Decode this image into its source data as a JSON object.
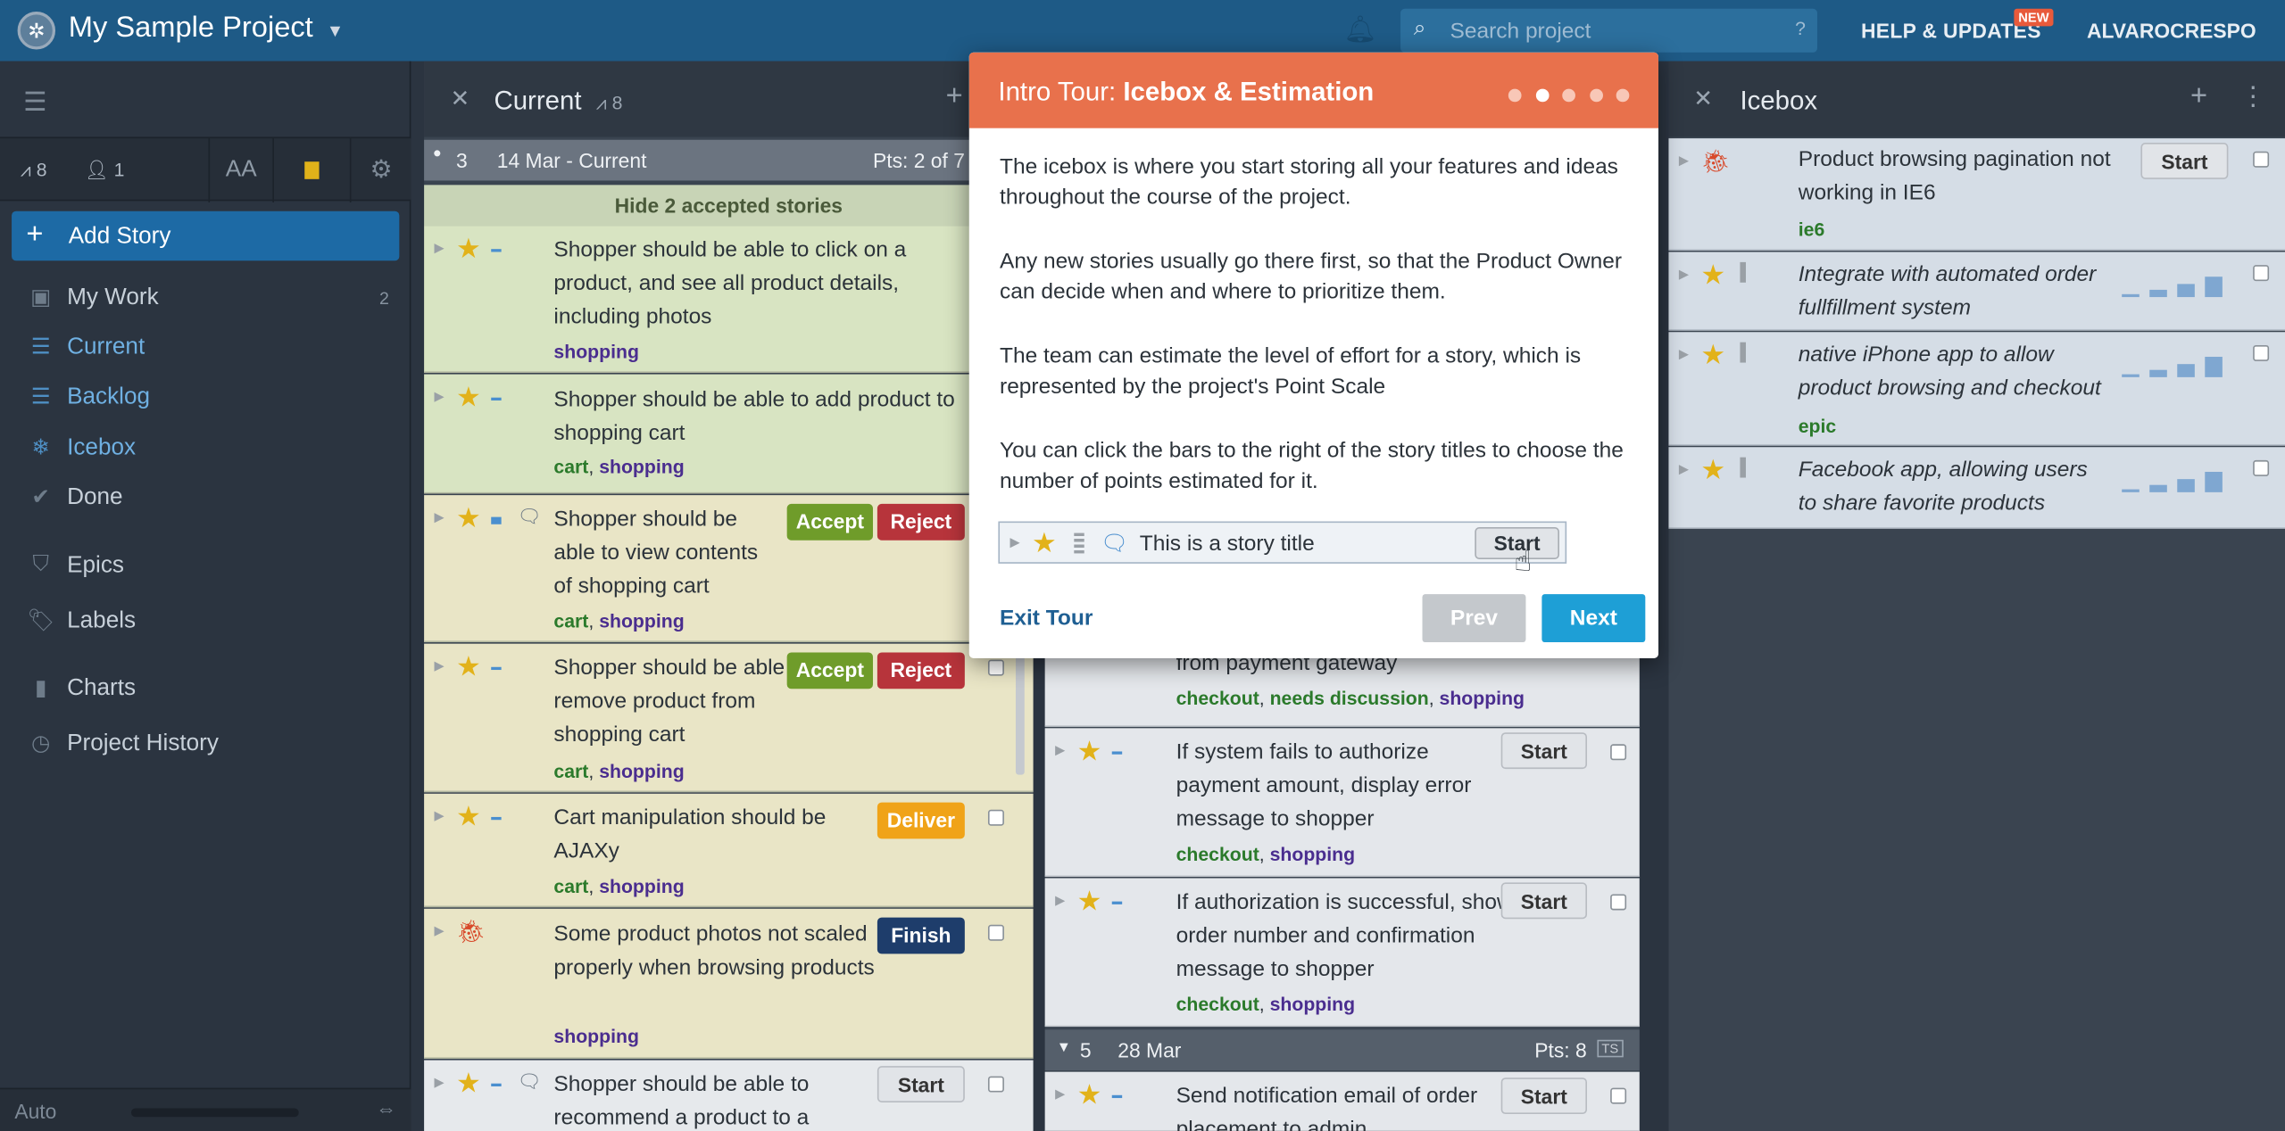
{
  "topbar": {
    "project_title": "My Sample Project",
    "search_placeholder": "Search project",
    "search_help": "?",
    "help_label": "HELP & UPDATES",
    "new_badge": "NEW",
    "username": "ALVAROCRESPO"
  },
  "sidebar": {
    "velocity": "8",
    "members": "1",
    "font_label": "AA",
    "add_story": "Add Story",
    "nav": [
      {
        "label": "My Work",
        "count": "2",
        "icon": "person-icon"
      },
      {
        "label": "Current",
        "count": "",
        "icon": "list-icon"
      },
      {
        "label": "Backlog",
        "count": "",
        "icon": "list-icon"
      },
      {
        "label": "Icebox",
        "count": "",
        "icon": "snowflake-icon"
      },
      {
        "label": "Done",
        "count": "",
        "icon": "check-icon"
      },
      {
        "label": "Epics",
        "count": "",
        "icon": "shield-icon"
      },
      {
        "label": "Labels",
        "count": "",
        "icon": "tag-icon"
      },
      {
        "label": "Charts",
        "count": "",
        "icon": "bar-chart-icon"
      },
      {
        "label": "Project History",
        "count": "",
        "icon": "clock-icon"
      }
    ],
    "bottom_auto": "Auto"
  },
  "current_panel": {
    "title": "Current",
    "velocity": "8",
    "iteration_number": "3",
    "iteration_date": "14 Mar - Current",
    "iteration_points": "Pts: 2 of 7",
    "hide_accepted": "Hide 2 accepted stories",
    "stories": [
      {
        "text": "Shopper should be able to click on a product, and see all product details, including photos",
        "labels": [
          "shopping"
        ]
      },
      {
        "text": "Shopper should be able to add product to shopping cart",
        "labels": [
          "cart",
          "shopping"
        ]
      },
      {
        "text": "Shopper should be able to view contents of shopping cart",
        "labels": [
          "cart",
          "shopping"
        ],
        "buttons": [
          "Accept",
          "Reject"
        ]
      },
      {
        "text": "Shopper should be able to remove product from shopping cart",
        "labels": [
          "cart",
          "shopping"
        ],
        "buttons": [
          "Accept",
          "Reject"
        ]
      },
      {
        "text": "Cart manipulation should be AJAXy",
        "labels": [
          "cart",
          "shopping"
        ],
        "buttons": [
          "Deliver"
        ]
      },
      {
        "text": "Some product photos not scaled properly when browsing products",
        "labels": [
          "shopping"
        ],
        "buttons": [
          "Finish"
        ]
      },
      {
        "text": "Shopper should be able to recommend a product to a",
        "labels": [],
        "buttons": [
          "Start"
        ]
      }
    ]
  },
  "backlog_panel": {
    "stories": [
      {
        "text": "from payment gateway",
        "labels": [
          "checkout",
          "needs discussion",
          "shopping"
        ]
      },
      {
        "text": "If system fails to authorize payment amount, display error message to shopper",
        "labels": [
          "checkout",
          "shopping"
        ],
        "button": "Start"
      },
      {
        "text": "If authorization is successful, show order number and confirmation message to shopper",
        "labels": [
          "checkout",
          "shopping"
        ],
        "button": "Start"
      },
      {
        "text": "Send notification email of order placement to admin",
        "labels": [],
        "button": "Start"
      }
    ],
    "iteration_number": "5",
    "iteration_date": "28 Mar",
    "iteration_points": "Pts: 8",
    "iteration_tag": "TS"
  },
  "icebox_panel": {
    "title": "Icebox",
    "stories": [
      {
        "text": "Product browsing pagination not working in IE6",
        "labels": [
          "ie6"
        ],
        "button": "Start",
        "italic": false
      },
      {
        "text": "Integrate with automated order fullfillment system",
        "labels": [],
        "italic": true
      },
      {
        "text": "native iPhone app to allow product browsing and checkout",
        "labels": [
          "epic"
        ],
        "italic": true
      },
      {
        "text": "Facebook app, allowing users to share favorite products",
        "labels": [],
        "italic": true
      }
    ]
  },
  "tour": {
    "title_prefix": "Intro Tour:",
    "title_main": "Icebox & Estimation",
    "paragraphs": [
      "The icebox is where you start storing all your features and ideas throughout the course of the project.",
      "Any new stories usually go there first, so that the Product Owner can decide when and where to prioritize them.",
      "The team can estimate the level of effort for a story, which is represented by the project's Point Scale",
      "You can click the bars to the right of the story titles to choose the number of points estimated for it."
    ],
    "sample_title": "This is a story title",
    "sample_button": "Start",
    "exit_label": "Exit Tour",
    "prev_label": "Prev",
    "next_label": "Next",
    "total_steps": 5,
    "active_step": 2
  },
  "colors": {
    "topbar": "#1e5a86",
    "tour_header": "#e8714c",
    "accept": "#6f9c2a",
    "reject": "#b7343b",
    "deliver": "#f0a318",
    "finish": "#1e3d6b",
    "next": "#1e9fd6"
  }
}
